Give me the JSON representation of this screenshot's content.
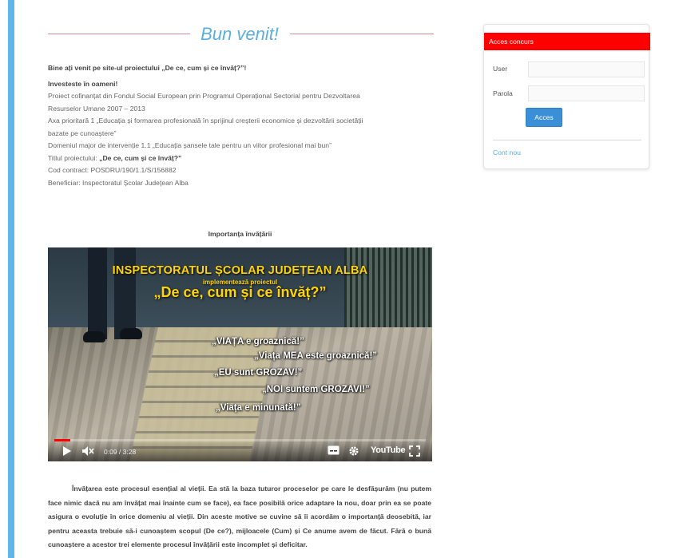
{
  "header": {
    "welcome_title": "Bun venit!"
  },
  "intro": {
    "line1": "Bine ați venit pe site-ul proiectului „De ce, cum și ce învăț?”!",
    "line2": "Investeste în oameni!",
    "line3": "Proiect cofinanțat din Fondul Social European prin Programul Operațional Sectorial pentru Dezvoltarea",
    "line4": "Resurselor Umane 2007 – 2013",
    "line5": "Axa prioritară 1 „Educația și formarea profesională în sprijinul creșterii economice și dezvoltării societății",
    "line6": "bazate pe cunoaștere”",
    "line7": "Domeniul major de intervenție 1.1 „Educația șansele tale pentru un viitor profesional mai bun”",
    "line8_label": "Titlul proiectului: ",
    "line8_value": "„De ce, cum și ce învăț?”",
    "line9": "Cod contract: POSDRU/190/1.1/S/156882",
    "line10": "Beneficiar: Inspectoratul Școlar Județean Alba"
  },
  "video": {
    "section_title": "Importanța învățării",
    "headline": "INSPECTORATUL ȘCOLAR JUDEȚEAN ALBA",
    "subline": "implementează proiectul",
    "project_title": "„De ce, cum și ce învăț?”",
    "phrases": [
      "„VIAȚA e groaznică!”",
      "„Viața MEA este groaznică!”",
      "„EU sunt GROZAV!”",
      "„NOI suntem GROZAVI!”",
      "„Viața e minunată!”"
    ],
    "time_display": "0:09 / 3:28",
    "progress_fraction": 0.043,
    "youtube_label": "YouTube",
    "progress_color": "#ff0000"
  },
  "article": {
    "text": "Învățarea este procesul esențial al vieții. Ea stă la baza tuturor proceselor pe care le desfășurăm (nu putem face nimic dacă nu am învățat mai înainte cum se face), ea face posibilă orice adaptare la nou, doar prin ea se poate asigura o evoluție în orice domeniu al vieții. Din aceste motive se cuvine să îi acordăm o importanță deosebită, iar pentru aceasta trebuie să-i cunoaștem scopul (De ce?), mijloacele (Cum) și Ce anume avem de făcut. Fără o bună cunoaștere a acestor trei elemente procesul învățării este incomplet și deficitar."
  },
  "sidebar": {
    "title": "Acces concurs",
    "user_label": "User",
    "password_label": "Parola",
    "user_value": "",
    "password_value": "",
    "submit_label": "Acces",
    "new_account_link": "Cont nou",
    "accent_color": "#ff0000"
  },
  "colors": {
    "accent_blue": "#5aaee0",
    "left_bar": "#5db7e8"
  }
}
